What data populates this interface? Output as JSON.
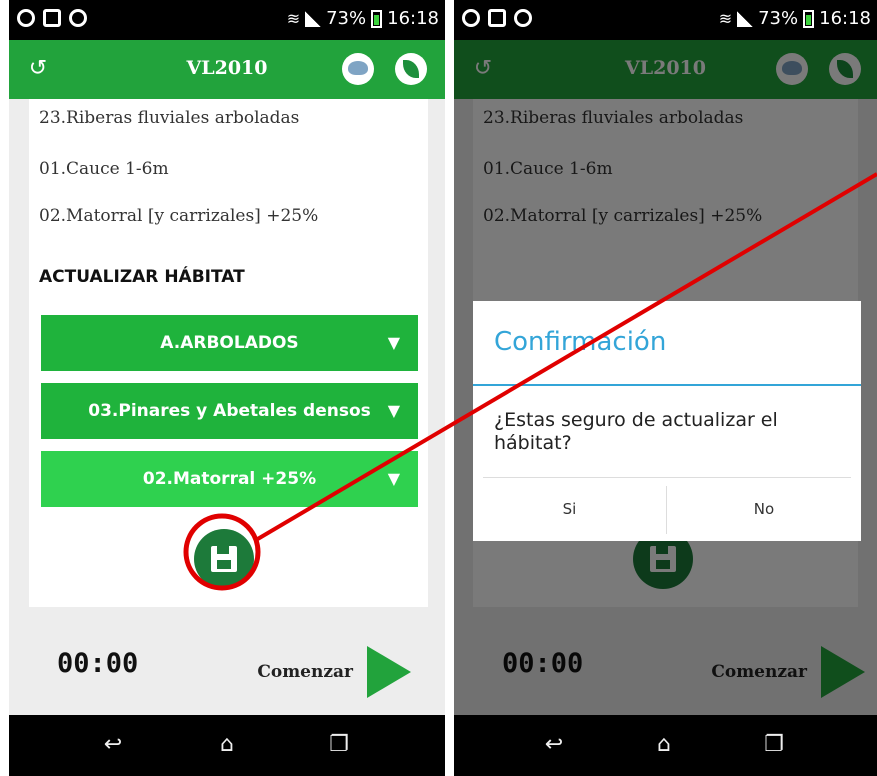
{
  "status": {
    "battery": "73%",
    "time": "16:18"
  },
  "app": {
    "title": "VL2010"
  },
  "habitat": {
    "current": [
      "23.Riberas fluviales arboladas",
      "01.Cauce 1-6m",
      "02.Matorral [y carrizales] +25%"
    ],
    "section_title": "ACTUALIZAR HÁBITAT",
    "selects": [
      "A.ARBOLADOS",
      "03.Pinares y Abetales densos",
      "02.Matorral +25%"
    ]
  },
  "timer": {
    "time": "00:00",
    "start_label": "Comenzar"
  },
  "dialog": {
    "title": "Confirmación",
    "message": "¿Estas seguro de actualizar el hábitat?",
    "yes": "Si",
    "no": "No"
  },
  "colors": {
    "primary": "#22a33c",
    "select_bg": "#1fb33c",
    "select_bg_active": "#2fd14f",
    "save_button": "#1d7a3a",
    "dialog_accent": "#33a5d8",
    "annotation": "#e00000"
  }
}
